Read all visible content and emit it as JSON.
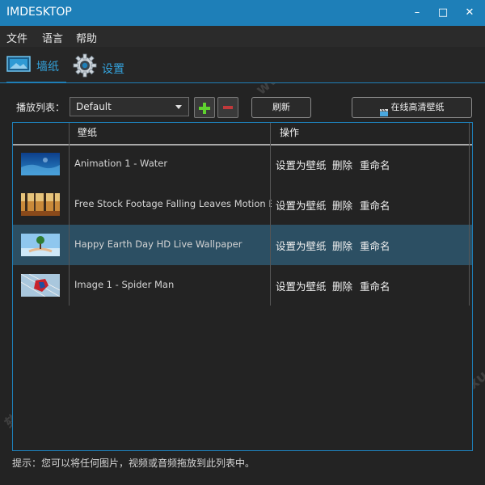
{
  "window": {
    "title": "IMDESKTOP",
    "minimize_glyph": "–",
    "maximize_glyph": "□",
    "close_glyph": "✕"
  },
  "menu": [
    "文件",
    "语言",
    "帮助"
  ],
  "tabs": [
    {
      "label": "墙纸",
      "icon": "wallpaper-icon",
      "active": true
    },
    {
      "label": "设置",
      "icon": "gear-icon",
      "active": false
    }
  ],
  "playlist": {
    "label": "播放列表：",
    "selected": "Default"
  },
  "buttons": {
    "refresh": "刷新",
    "online_hd": "在线高清壁纸"
  },
  "table": {
    "headers": [
      "壁纸",
      "操作"
    ],
    "rows": [
      {
        "name": "Animation 1 - Water",
        "thumb": "water",
        "selected": false
      },
      {
        "name": "Free Stock Footage Falling Leaves Motion Backg",
        "thumb": "forest",
        "selected": false
      },
      {
        "name": "Happy Earth Day HD Live Wallpaper",
        "thumb": "earth",
        "selected": true
      },
      {
        "name": "Image 1 - Spider Man",
        "thumb": "spider",
        "selected": false
      }
    ],
    "actions": [
      "设置为壁纸",
      "删除",
      "重命名"
    ]
  },
  "hint": "提示：您可以将任何图片，视频或音频拖放到此列表中。",
  "colors": {
    "accent": "#1e7fb8",
    "background": "#232323",
    "selected_row": "#2c4f63",
    "link_text": "#34a3dc"
  }
}
